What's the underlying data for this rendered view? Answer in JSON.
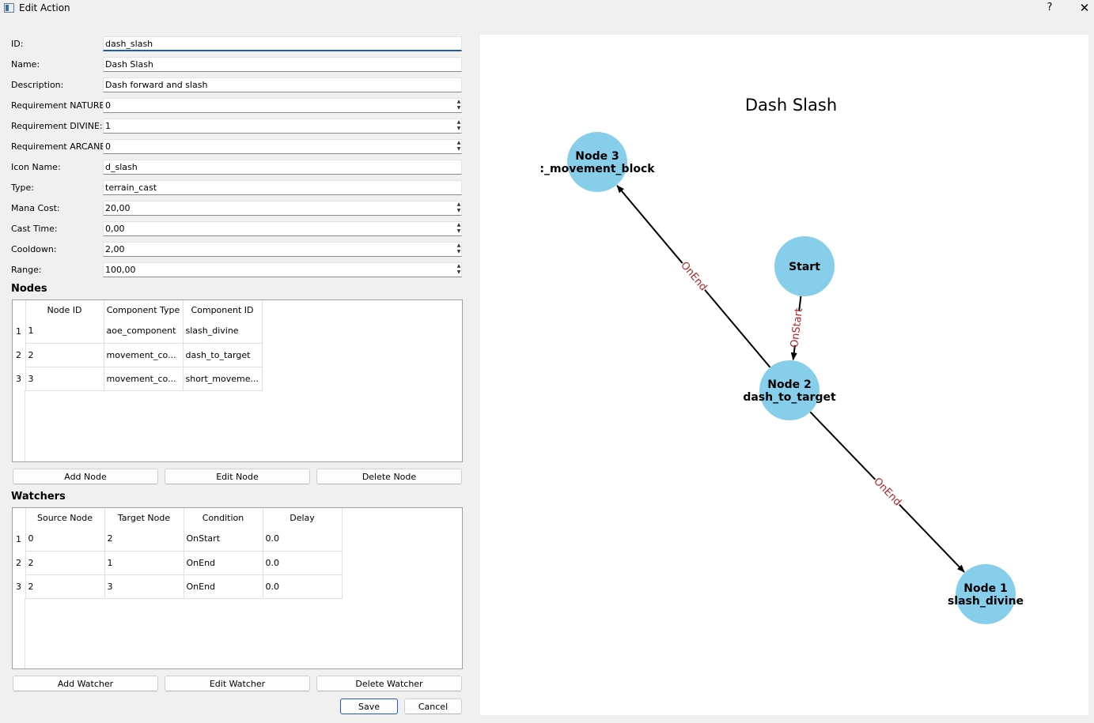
{
  "window": {
    "title": "Edit Action",
    "help": "?",
    "close": "✕"
  },
  "form": {
    "fields": [
      {
        "key": "id",
        "label": "ID:",
        "value": "dash_slash",
        "spin": false,
        "focused": true
      },
      {
        "key": "name",
        "label": "Name:",
        "value": "Dash Slash",
        "spin": false
      },
      {
        "key": "description",
        "label": "Description:",
        "value": "Dash forward and slash",
        "spin": false
      },
      {
        "key": "req_nature",
        "label": "Requirement NATURE:",
        "value": "0",
        "spin": true
      },
      {
        "key": "req_divine",
        "label": "Requirement DIVINE:",
        "value": "1",
        "spin": true
      },
      {
        "key": "req_arcane",
        "label": "Requirement ARCANE:",
        "value": "0",
        "spin": true
      },
      {
        "key": "icon_name",
        "label": "Icon Name:",
        "value": "d_slash",
        "spin": false
      },
      {
        "key": "type",
        "label": "Type:",
        "value": "terrain_cast",
        "spin": false
      },
      {
        "key": "mana_cost",
        "label": "Mana Cost:",
        "value": "20,00",
        "spin": true
      },
      {
        "key": "cast_time",
        "label": "Cast Time:",
        "value": "0,00",
        "spin": true
      },
      {
        "key": "cooldown",
        "label": "Cooldown:",
        "value": "2,00",
        "spin": true
      },
      {
        "key": "range",
        "label": "Range:",
        "value": "100,00",
        "spin": true
      }
    ]
  },
  "nodes": {
    "title": "Nodes",
    "columns": [
      "Node ID",
      "Component Type",
      "Component ID"
    ],
    "rows": [
      {
        "num": "1",
        "cells": [
          "1",
          "aoe_component",
          "slash_divine"
        ]
      },
      {
        "num": "2",
        "cells": [
          "2",
          "movement_co...",
          "dash_to_target"
        ]
      },
      {
        "num": "3",
        "cells": [
          "3",
          "movement_co...",
          "short_moveme..."
        ]
      }
    ],
    "buttons": {
      "add": "Add Node",
      "edit": "Edit Node",
      "delete": "Delete Node"
    }
  },
  "watchers": {
    "title": "Watchers",
    "columns": [
      "Source Node",
      "Target Node",
      "Condition",
      "Delay"
    ],
    "rows": [
      {
        "num": "1",
        "cells": [
          "0",
          "2",
          "OnStart",
          "0.0"
        ]
      },
      {
        "num": "2",
        "cells": [
          "2",
          "1",
          "OnEnd",
          "0.0"
        ]
      },
      {
        "num": "3",
        "cells": [
          "2",
          "3",
          "OnEnd",
          "0.0"
        ]
      }
    ],
    "buttons": {
      "add": "Add Watcher",
      "edit": "Edit Watcher",
      "delete": "Delete Watcher"
    }
  },
  "dialog_buttons": {
    "save": "Save",
    "cancel": "Cancel"
  },
  "graph": {
    "title": "Dash Slash",
    "node_color": "#87ceeb",
    "edge_label_color": "#b22222",
    "nodes": [
      {
        "id": "start",
        "line1": "Start",
        "line2": ""
      },
      {
        "id": "n3",
        "line1": "Node 3",
        "line2": ":_movement_block"
      },
      {
        "id": "n2",
        "line1": "Node 2",
        "line2": "dash_to_target"
      },
      {
        "id": "n1",
        "line1": "Node 1",
        "line2": "slash_divine"
      }
    ],
    "edges": [
      {
        "from": "start",
        "to": "n2",
        "label": "OnStart"
      },
      {
        "from": "n2",
        "to": "n3",
        "label": "OnEnd"
      },
      {
        "from": "n2",
        "to": "n1",
        "label": "OnEnd"
      }
    ]
  }
}
